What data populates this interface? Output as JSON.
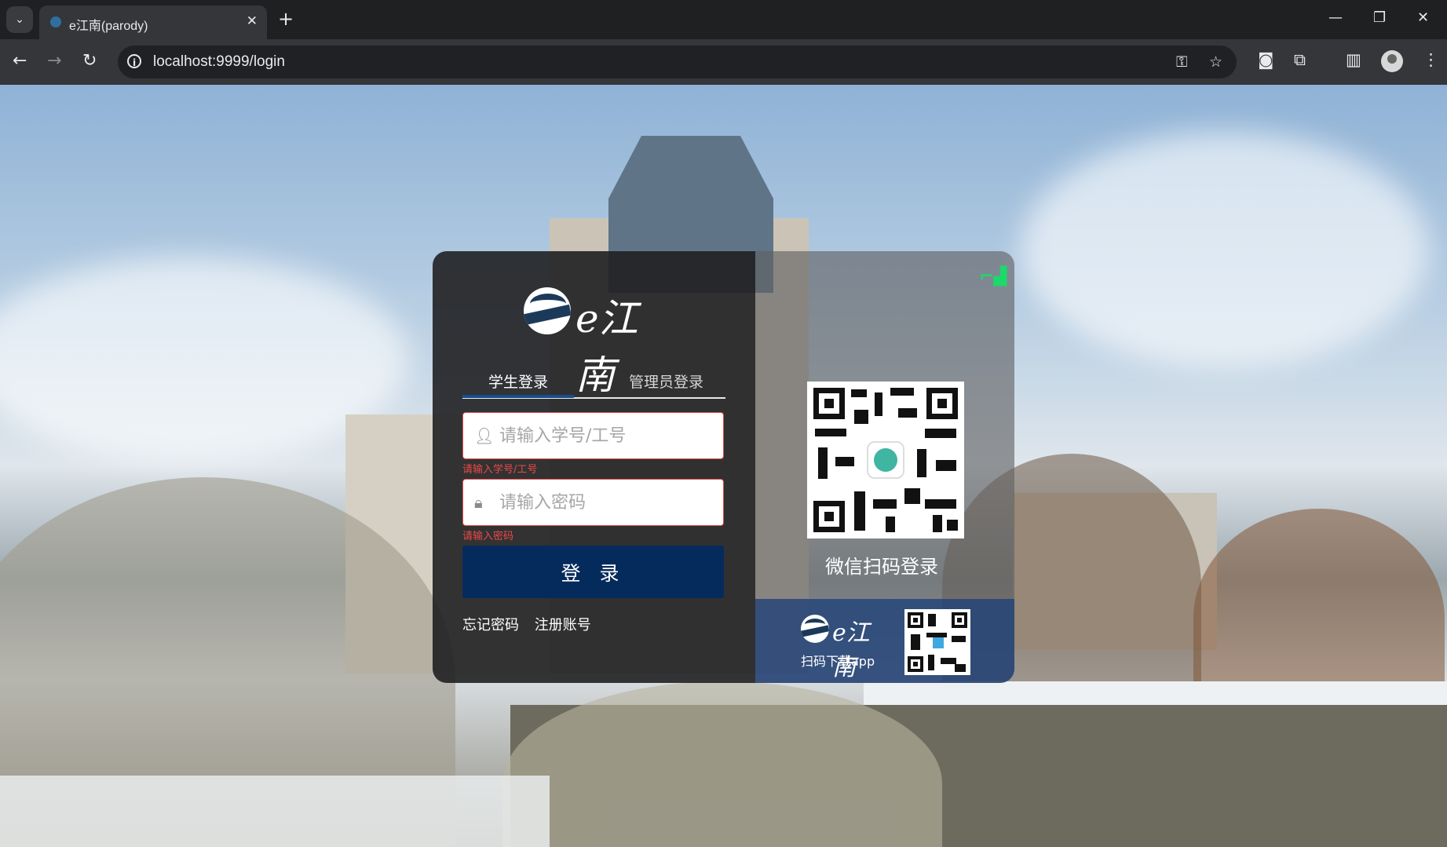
{
  "browser": {
    "tab_title": "e江南(parody)",
    "url": "localhost:9999/login"
  },
  "login": {
    "logo_text": "e江南",
    "tabs": [
      {
        "label": "学生登录",
        "active": true
      },
      {
        "label": "管理员登录",
        "active": false
      }
    ],
    "username_placeholder": "请输入学号/工号",
    "username_error": "请输入学号/工号",
    "password_placeholder": "请输入密码",
    "password_error": "请输入密码",
    "login_button": "登 录",
    "forgot_password": "忘记密码",
    "register": "注册账号"
  },
  "qr": {
    "wechat_label": "微信扫码登录",
    "app_logo_text": "e江南",
    "app_label": "扫码下载app"
  },
  "colors": {
    "primary_button": "#052b5c",
    "error": "#ee4747",
    "tab_indicator": "#1b4c8c",
    "corner_icon": "#1bd96a"
  },
  "icons": {
    "username": "user-icon",
    "password": "lock-icon",
    "corner": "qr-corner-icon"
  }
}
